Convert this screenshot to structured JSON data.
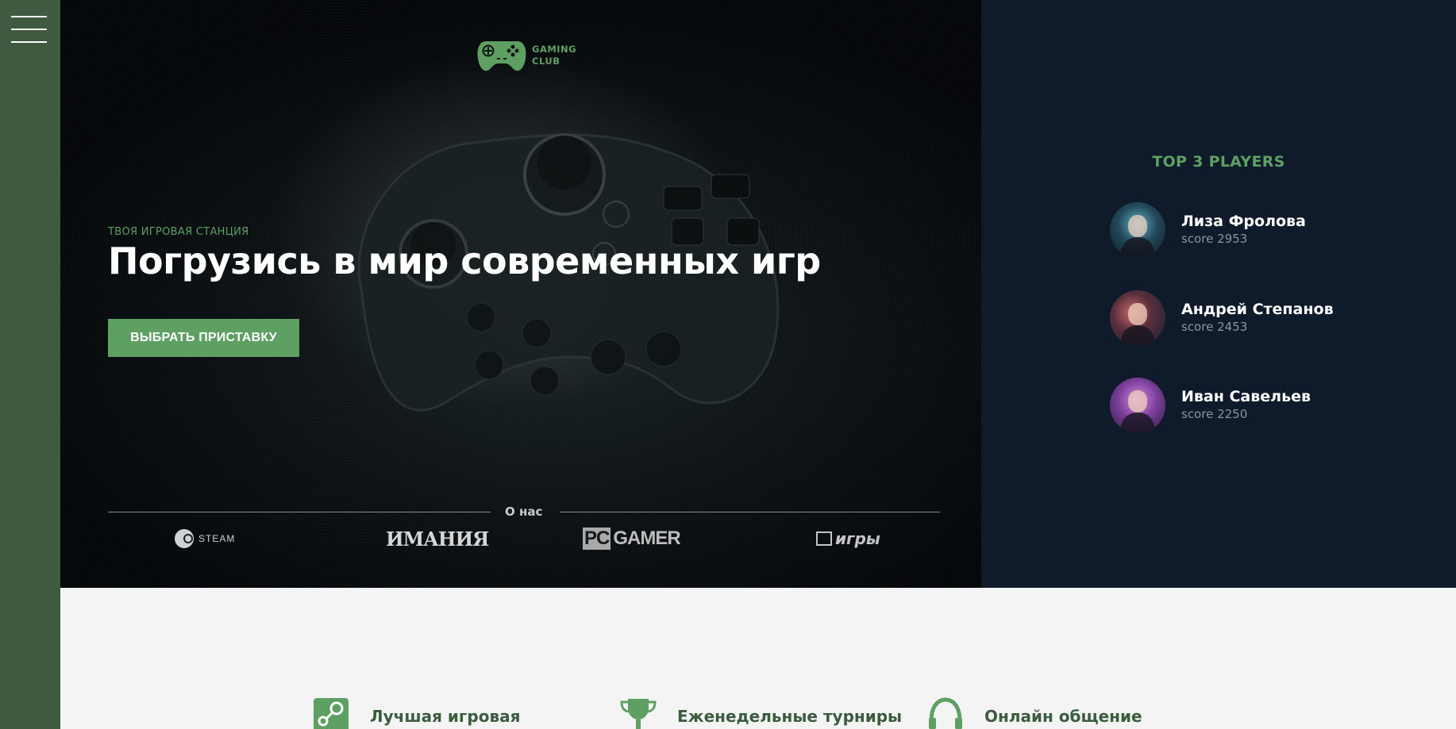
{
  "menu": {
    "icon": "hamburger-menu-icon"
  },
  "logo": {
    "line1": "GAMING",
    "line2": "CLUB",
    "icon": "gamepad-icon",
    "color": "#5e9f62"
  },
  "hero": {
    "tagline": "ТВОЯ ИГРОВАЯ СТАНЦИЯ",
    "headline": "Погрузись в мир современных игр",
    "cta_label": "ВЫБРАТЬ ПРИСТАВКУ",
    "about_label": "О нас",
    "partners": [
      {
        "name": "STEAM",
        "icon": "steam-icon"
      },
      {
        "name": "ИМАНИЯ"
      },
      {
        "name_a": "PC",
        "name_b": "GAMER"
      },
      {
        "name": "игры",
        "icon": "igry-logo-icon"
      }
    ]
  },
  "top_players": {
    "title": "TOP 3 PLAYERS",
    "players": [
      {
        "name": "Лиза Фролова",
        "score": "score 2953"
      },
      {
        "name": "Андрей Степанов",
        "score": "score 2453"
      },
      {
        "name": "Иван Савельев",
        "score": "score 2250"
      }
    ]
  },
  "features": [
    {
      "label": "Лучшая игровая",
      "icon": "steam-icon"
    },
    {
      "label": "Еженедельные турниры",
      "icon": "trophy-icon"
    },
    {
      "label": "Онлайн общение",
      "icon": "headphones-icon"
    }
  ],
  "colors": {
    "accent": "#5e9f62",
    "sidebar": "#3f5a40",
    "panel": "#0f1b2b",
    "feature_text": "#3c5c3e"
  }
}
